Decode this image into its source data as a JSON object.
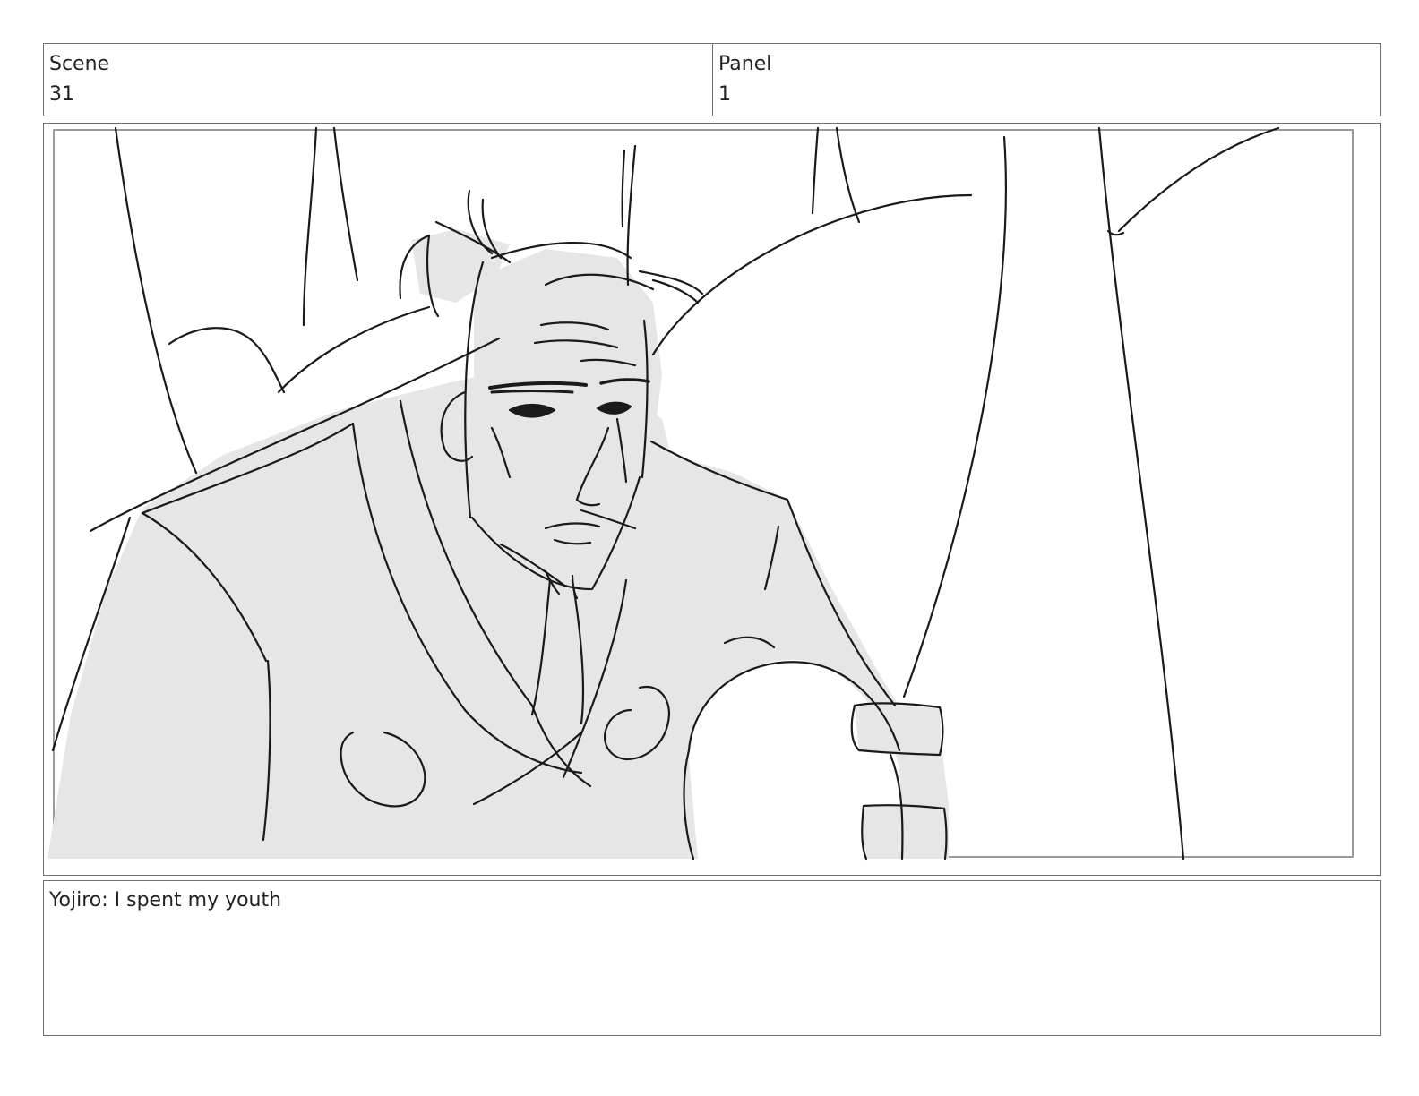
{
  "scene": {
    "label": "Scene",
    "value": "31"
  },
  "panel": {
    "label": "Panel",
    "value": "1"
  },
  "artwork": {
    "icon": "character-sketch-icon",
    "tone_fill": "#e6e6e6",
    "line_color": "#1a1a1a"
  },
  "caption": {
    "text": "Yojiro: I spent my youth"
  }
}
